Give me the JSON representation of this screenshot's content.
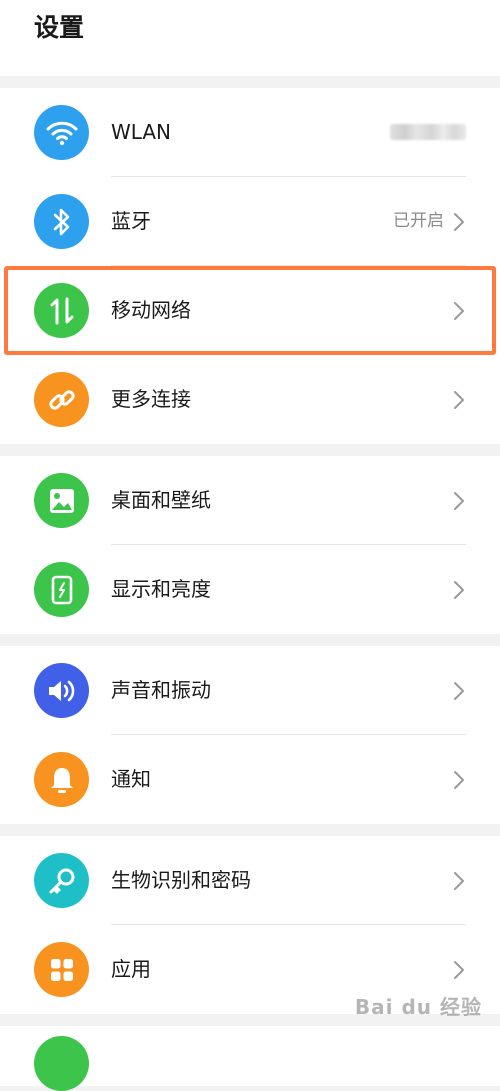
{
  "header": {
    "title": "设置"
  },
  "groups": [
    {
      "items": [
        {
          "label": "WLAN",
          "value": "",
          "icon": "wifi-icon",
          "color": "#2ea1ee"
        },
        {
          "label": "蓝牙",
          "value": "已开启",
          "icon": "bluetooth-icon",
          "color": "#2ea1ee"
        },
        {
          "label": "移动网络",
          "value": "",
          "icon": "mobile-data-icon",
          "color": "#3cc44b"
        },
        {
          "label": "更多连接",
          "value": "",
          "icon": "link-icon",
          "color": "#f8931f"
        }
      ]
    },
    {
      "items": [
        {
          "label": "桌面和壁纸",
          "value": "",
          "icon": "wallpaper-icon",
          "color": "#3cc44b"
        },
        {
          "label": "显示和亮度",
          "value": "",
          "icon": "display-icon",
          "color": "#3cc44b"
        }
      ]
    },
    {
      "items": [
        {
          "label": "声音和振动",
          "value": "",
          "icon": "sound-icon",
          "color": "#4060e8"
        },
        {
          "label": "通知",
          "value": "",
          "icon": "bell-icon",
          "color": "#f8931f"
        }
      ]
    },
    {
      "items": [
        {
          "label": "生物识别和密码",
          "value": "",
          "icon": "key-icon",
          "color": "#1fbfc8"
        },
        {
          "label": "应用",
          "value": "",
          "icon": "apps-icon",
          "color": "#f8931f"
        }
      ]
    }
  ],
  "highlight_color": "#ff7a3c",
  "watermark": {
    "text": "Bai du 经验"
  }
}
